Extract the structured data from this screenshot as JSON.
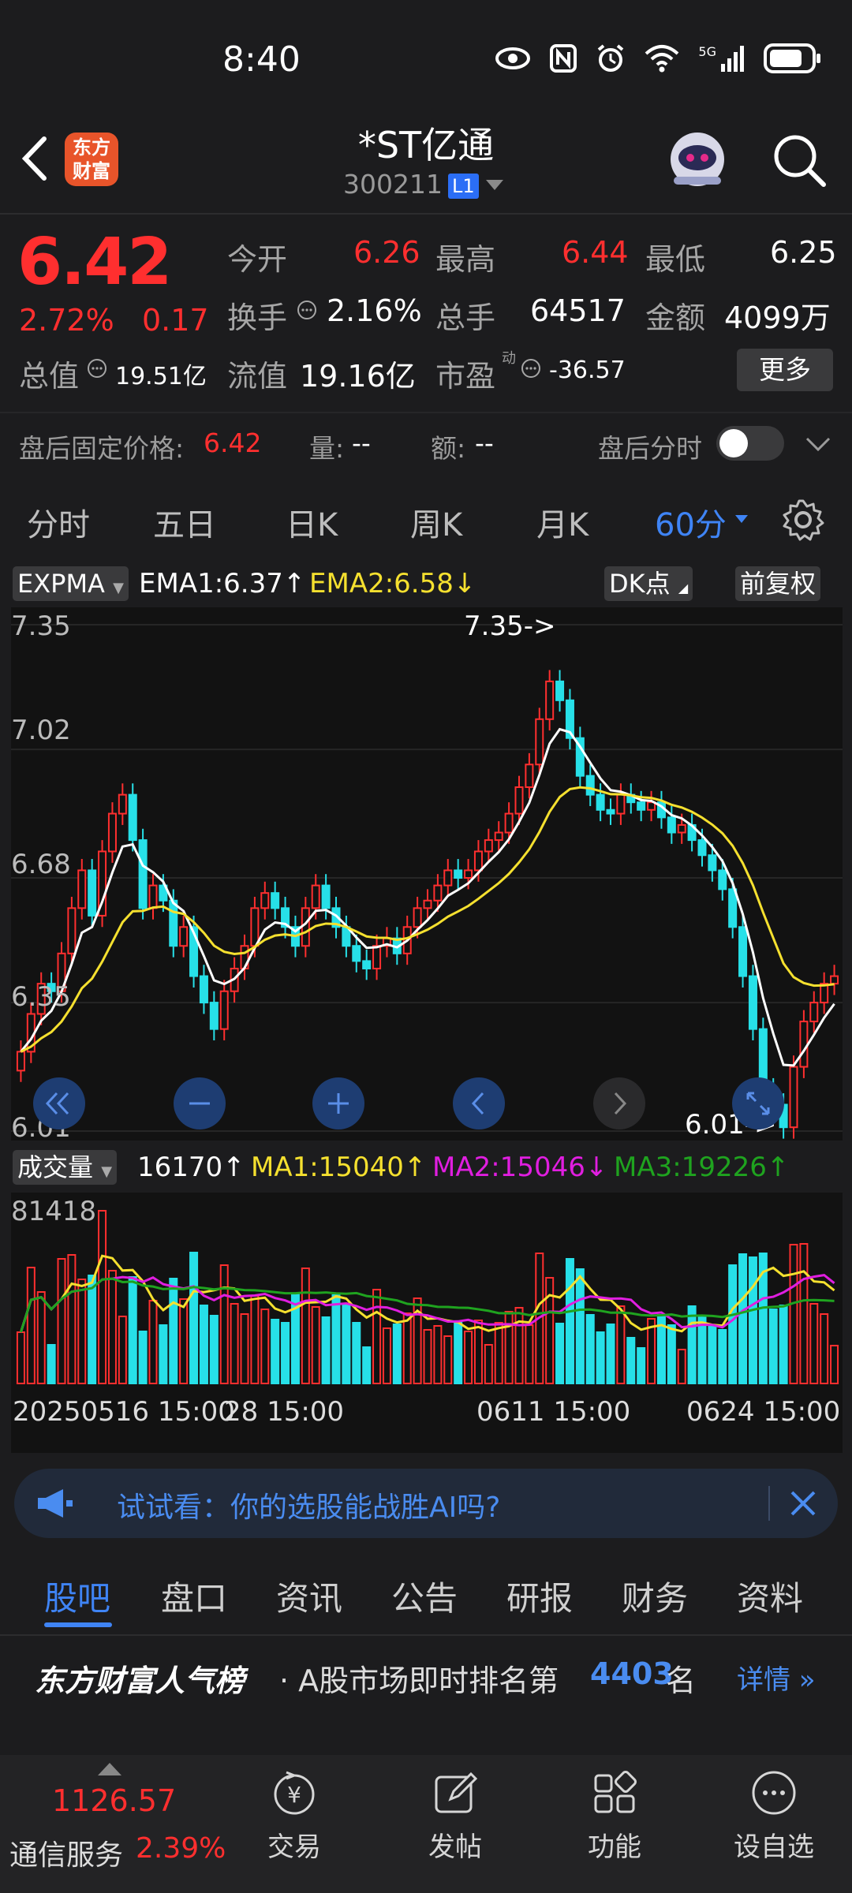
{
  "status": {
    "time": "8:40",
    "network": "5G"
  },
  "header": {
    "app_logo": "东方\n财富",
    "title": "*ST亿通",
    "code": "300211",
    "level": "L1"
  },
  "quote": {
    "price": "6.42",
    "change_pct": "2.72%",
    "change": "0.17",
    "open_label": "今开",
    "open": "6.26",
    "high_label": "最高",
    "high": "6.44",
    "low_label": "最低",
    "low": "6.25",
    "turnover_label": "换手",
    "turnover": "2.16%",
    "volume_label": "总手",
    "volume": "64517",
    "amount_label": "金额",
    "amount": "4099万",
    "mktcap_label": "总值",
    "mktcap": "19.51亿",
    "float_label": "流值",
    "float": "19.16亿",
    "pe_label": "市盈",
    "pe_sup": "动",
    "pe": "-36.57",
    "more": "更多"
  },
  "afterhours": {
    "label": "盘后固定价格:",
    "price": "6.42",
    "vol_label": "量:",
    "vol": "--",
    "amt_label": "额:",
    "amt": "--",
    "timeshare_label": "盘后分时"
  },
  "chart_tabs": [
    "分时",
    "五日",
    "日K",
    "周K",
    "月K",
    "60分"
  ],
  "indicator": {
    "name": "EXPMA",
    "ema1": "EMA1:6.37",
    "ema2": "EMA2:6.58",
    "dk": "DK点",
    "adj": "前复权"
  },
  "chart_data": {
    "type": "candlestick",
    "y_ticks": [
      "7.35",
      "7.02",
      "6.68",
      "6.35",
      "6.01"
    ],
    "ylim": [
      6.01,
      7.35
    ],
    "annotations": [
      "7.35->",
      "6.01->"
    ],
    "closes": [
      6.22,
      6.32,
      6.4,
      6.38,
      6.48,
      6.6,
      6.7,
      6.58,
      6.75,
      6.85,
      6.9,
      6.78,
      6.6,
      6.66,
      6.62,
      6.5,
      6.55,
      6.42,
      6.35,
      6.28,
      6.38,
      6.44,
      6.5,
      6.6,
      6.64,
      6.6,
      6.55,
      6.5,
      6.6,
      6.66,
      6.6,
      6.55,
      6.5,
      6.46,
      6.44,
      6.5,
      6.52,
      6.48,
      6.55,
      6.6,
      6.62,
      6.66,
      6.7,
      6.68,
      6.7,
      6.75,
      6.78,
      6.8,
      6.85,
      6.92,
      6.98,
      7.1,
      7.2,
      7.15,
      7.05,
      6.95,
      6.9,
      6.86,
      6.85,
      6.9,
      6.88,
      6.86,
      6.88,
      6.84,
      6.8,
      6.82,
      6.78,
      6.74,
      6.7,
      6.65,
      6.55,
      6.42,
      6.28,
      6.12,
      6.08,
      6.02,
      6.18,
      6.3,
      6.35,
      6.4,
      6.42
    ]
  },
  "volume": {
    "name": "成交量",
    "current": "16170",
    "ma1": "MA1:15040",
    "ma2": "MA2:15046",
    "ma3": "MA3:19226",
    "max_tick": "81418",
    "x_labels": [
      "20250516 15:00",
      "28 15:00",
      "0611 15:00",
      "0624 15:00"
    ]
  },
  "banner": {
    "text": "试试看：你的选股能战胜AI吗?"
  },
  "bottom_tabs": [
    "股吧",
    "盘口",
    "资讯",
    "公告",
    "研报",
    "财务",
    "资料"
  ],
  "rank": {
    "brand": "东方财富人气榜",
    "text": "· A股市场即时排名第",
    "num": "4403",
    "suffix": "名",
    "details": "详情"
  },
  "nav": {
    "index_value": "1126.57",
    "index_name": "通信服务",
    "index_pct": "2.39%",
    "items": [
      "交易",
      "发帖",
      "功能",
      "设自选"
    ]
  },
  "colors": {
    "up": "#ff2f2f",
    "down": "#27e0e8",
    "ema1": "#ffffff",
    "ema2": "#f5e02f",
    "ma1": "#f5e02f",
    "ma2": "#e01ee0",
    "ma3": "#1fa31f",
    "accent": "#3f84f5"
  }
}
